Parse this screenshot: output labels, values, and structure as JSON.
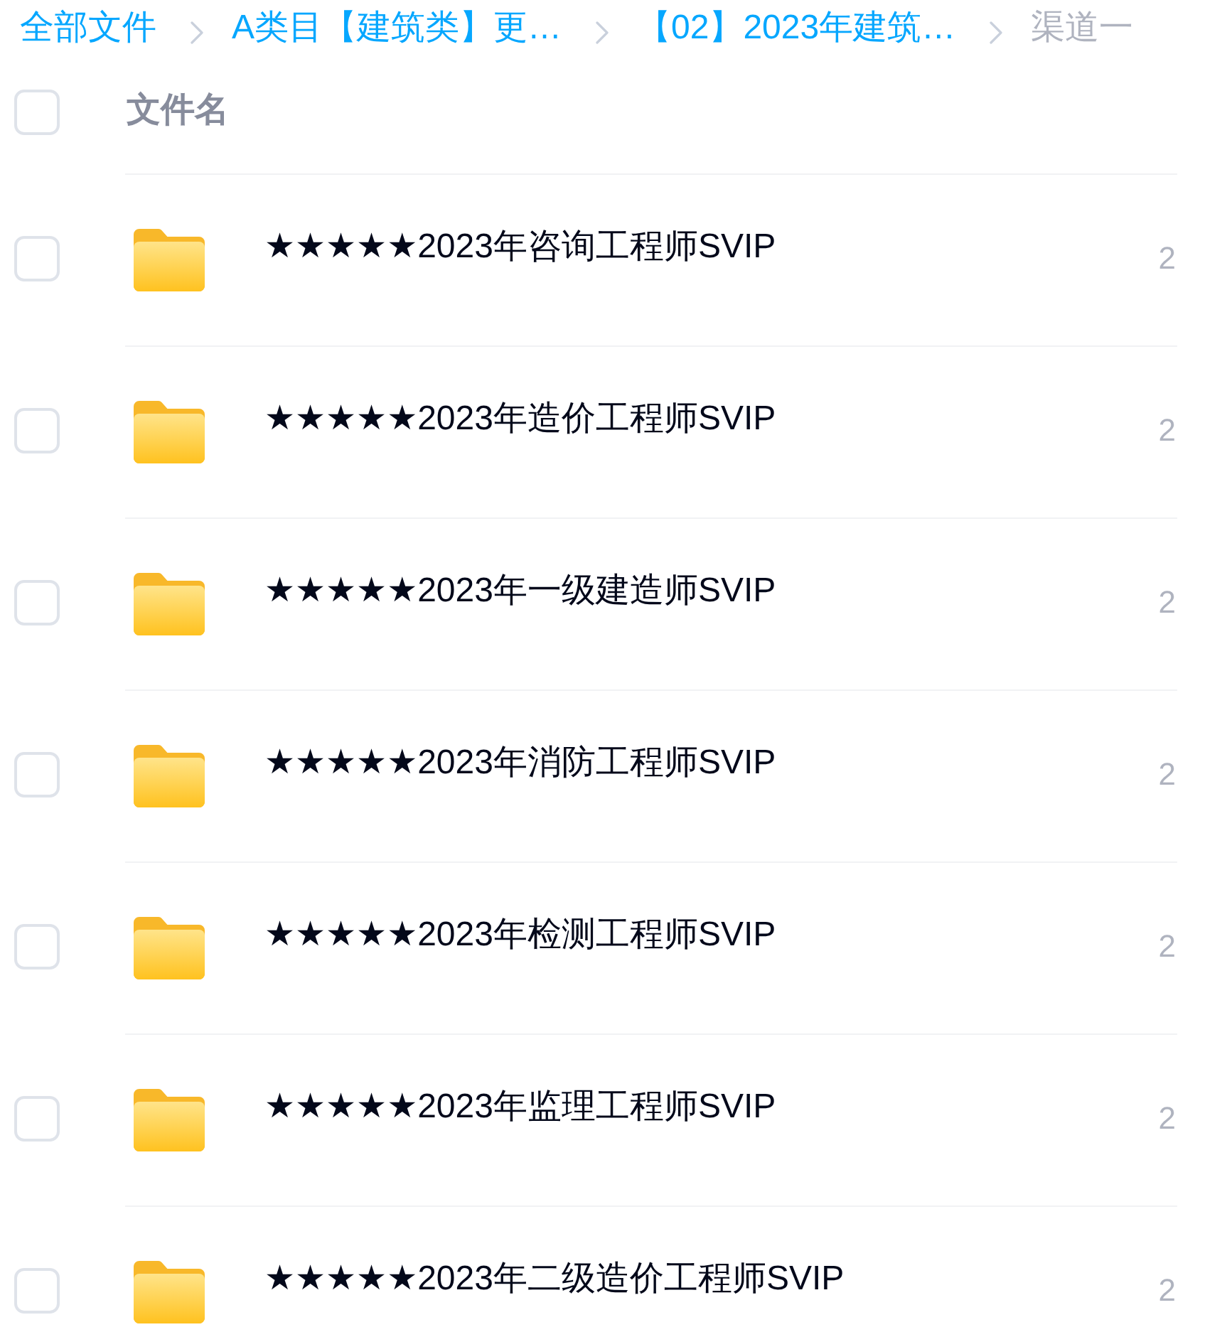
{
  "breadcrumb": [
    {
      "label": "全部文件",
      "current": false
    },
    {
      "label": "A类目【建筑类】更…",
      "current": false
    },
    {
      "label": "【02】2023年建筑…",
      "current": false
    },
    {
      "label": "渠道一",
      "current": true
    }
  ],
  "table": {
    "header": {
      "checked": false,
      "columns": [
        "文件名"
      ]
    },
    "rows": [
      {
        "checked": false,
        "name": "★★★★★2023年咨询工程师SVIP",
        "column_2": "2"
      },
      {
        "checked": false,
        "name": "★★★★★2023年造价工程师SVIP",
        "column_2": "2"
      },
      {
        "checked": false,
        "name": "★★★★★2023年一级建造师SVIP",
        "column_2": "2"
      },
      {
        "checked": false,
        "name": "★★★★★2023年消防工程师SVIP",
        "column_2": "2"
      },
      {
        "checked": false,
        "name": "★★★★★2023年检测工程师SVIP",
        "column_2": "2"
      },
      {
        "checked": false,
        "name": "★★★★★2023年监理工程师SVIP",
        "column_2": "2"
      },
      {
        "checked": false,
        "name": "★★★★★2023年二级造价工程师SVIP",
        "column_2": "2"
      }
    ]
  }
}
